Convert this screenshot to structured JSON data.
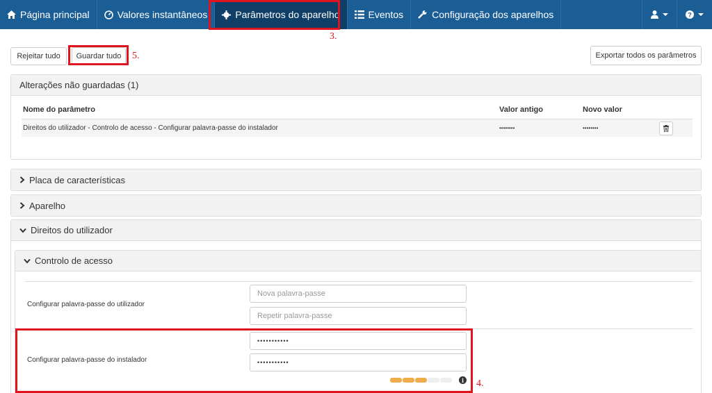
{
  "navbar": {
    "items": [
      {
        "label": "Página principal",
        "icon": "home-icon"
      },
      {
        "label": "Valores instantâneos",
        "icon": "gauge-icon"
      },
      {
        "label": "Parâmetros do aparelho",
        "icon": "gear-icon"
      },
      {
        "label": "Eventos",
        "icon": "list-icon"
      },
      {
        "label": "Configuração dos aparelhos",
        "icon": "wrench-icon"
      }
    ],
    "active_index": 2,
    "right": [
      {
        "icon": "user-icon"
      },
      {
        "icon": "help-icon"
      }
    ]
  },
  "annotations": {
    "a3": "3.",
    "a4": "4.",
    "a5": "5."
  },
  "toolbar": {
    "reject_label": "Rejeitar tudo",
    "save_label": "Guardar tudo",
    "export_label": "Exportar todos os parâmetros"
  },
  "unsaved": {
    "title": "Alterações não guardadas (1)",
    "columns": {
      "name": "Nome do parâmetro",
      "old": "Valor antigo",
      "new": "Novo valor"
    },
    "rows": [
      {
        "name": "Direitos do utilizador - Controlo de acesso - Configurar palavra-passe do instalador",
        "old": "••••••••",
        "new": "••••••••"
      }
    ]
  },
  "sections": [
    {
      "title": "Placa de características",
      "expanded": false
    },
    {
      "title": "Aparelho",
      "expanded": false
    },
    {
      "title": "Direitos do utilizador",
      "expanded": true
    }
  ],
  "access_control": {
    "title": "Controlo de acesso",
    "user_pw": {
      "label": "Configurar palavra-passe do utilizador",
      "new_placeholder": "Nova palavra-passe",
      "repeat_placeholder": "Repetir palavra-passe"
    },
    "installer_pw": {
      "label": "Configurar palavra-passe do instalador",
      "value1": "•••••••••••",
      "value2": "•••••••••••",
      "strength_filled": 3,
      "strength_total": 5
    }
  },
  "colors": {
    "navbar": "#1b5e96",
    "navbar_active": "#0f3e66",
    "annotation": "#e0141e",
    "strength_on": "#f0ad4e",
    "strength_off": "#eeeeee"
  }
}
